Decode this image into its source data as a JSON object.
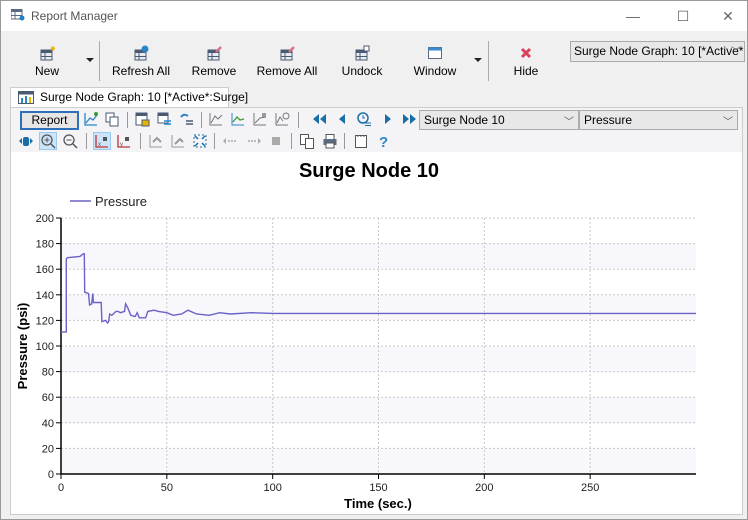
{
  "window": {
    "title": "Report Manager",
    "controls": {
      "minimize": "—",
      "maximize": "☐",
      "close": "✕"
    }
  },
  "ribbon": {
    "buttons": [
      {
        "id": "new",
        "label": "New",
        "icon": "new-report-icon",
        "has_dropdown": true
      },
      {
        "id": "refresh-all",
        "label": "Refresh All",
        "icon": "refresh-all-icon"
      },
      {
        "id": "remove",
        "label": "Remove",
        "icon": "remove-icon"
      },
      {
        "id": "remove-all",
        "label": "Remove All",
        "icon": "remove-all-icon"
      },
      {
        "id": "undock",
        "label": "Undock",
        "icon": "undock-icon"
      },
      {
        "id": "window",
        "label": "Window",
        "icon": "window-icon",
        "has_dropdown": true
      },
      {
        "id": "hide",
        "label": "Hide",
        "icon": "hide-icon"
      }
    ],
    "graph_selector": {
      "value": "Surge Node Graph: 10 [*Active*",
      "chevron": "﹀"
    }
  },
  "tab": {
    "label": "Surge Node Graph: 10 [*Active*:Surge]",
    "icon": "graph-tab-icon"
  },
  "toolbar": {
    "report_label": "Report",
    "row1_icons": [
      "chart-properties-icon",
      "copy-chart-icon",
      "save-layout-icon",
      "filter-icon",
      "undo-filter-icon",
      "line-chart-icon",
      "area-chart-icon",
      "xy-chart-icon",
      "time-chart-icon",
      "first-icon",
      "previous-icon",
      "time-step-icon",
      "next-icon",
      "last-icon"
    ],
    "row2_icons": [
      "pan-icon",
      "zoom-in-icon",
      "zoom-out-icon",
      "lock-x-axis-icon",
      "lock-y-axis-icon",
      "undo-zoom-icon",
      "redo-zoom-icon",
      "fit-all-icon",
      "step-back-icon",
      "step-forward-icon",
      "stop-icon",
      "copy-icon",
      "print-icon",
      "notes-icon",
      "help-icon"
    ],
    "element_select": {
      "value": "Surge Node 10",
      "chevron": "﹀"
    },
    "attribute_select": {
      "value": "Pressure",
      "chevron": "﹀"
    }
  },
  "colors": {
    "series": "#6a62c8",
    "accent": "#2e6fb7",
    "nav": "#1a6ea8",
    "hide_red": "#d9405a"
  },
  "chart_data": {
    "type": "line",
    "title": "Surge Node 10",
    "xlabel": "Time (sec.)",
    "ylabel": "Pressure (psi)",
    "xlim": [
      0,
      300
    ],
    "ylim": [
      0,
      200
    ],
    "xticks": [
      0,
      50,
      100,
      150,
      200,
      250
    ],
    "yticks": [
      0,
      20,
      40,
      60,
      80,
      100,
      120,
      140,
      160,
      180,
      200
    ],
    "grid": true,
    "legend_position": "top-left",
    "series": [
      {
        "name": "Pressure",
        "x": [
          0,
          2.5,
          2.5,
          3,
          9,
          10.5,
          11,
          11.2,
          13,
          13.5,
          14.5,
          15,
          15.3,
          16,
          16.3,
          19,
          19.3,
          21,
          22,
          22.5,
          23,
          24,
          26,
          27,
          28,
          30,
          30.5,
          31.5,
          32,
          33,
          35,
          36,
          37,
          40,
          41,
          44,
          46,
          50,
          53,
          57,
          60,
          64,
          70,
          75,
          80,
          90,
          100,
          120,
          150,
          300
        ],
        "y": [
          111,
          111,
          168,
          169,
          170,
          172,
          172,
          142,
          141,
          132,
          133,
          141,
          134,
          134,
          134,
          134,
          119,
          120,
          118,
          119,
          125,
          124,
          127,
          127,
          126,
          127,
          133,
          130,
          128,
          124,
          123,
          126,
          122,
          122,
          127,
          128,
          127,
          126,
          124,
          125,
          128,
          125,
          124,
          126,
          125,
          126,
          125.5,
          125.5,
          125.5,
          125.5
        ]
      }
    ]
  }
}
